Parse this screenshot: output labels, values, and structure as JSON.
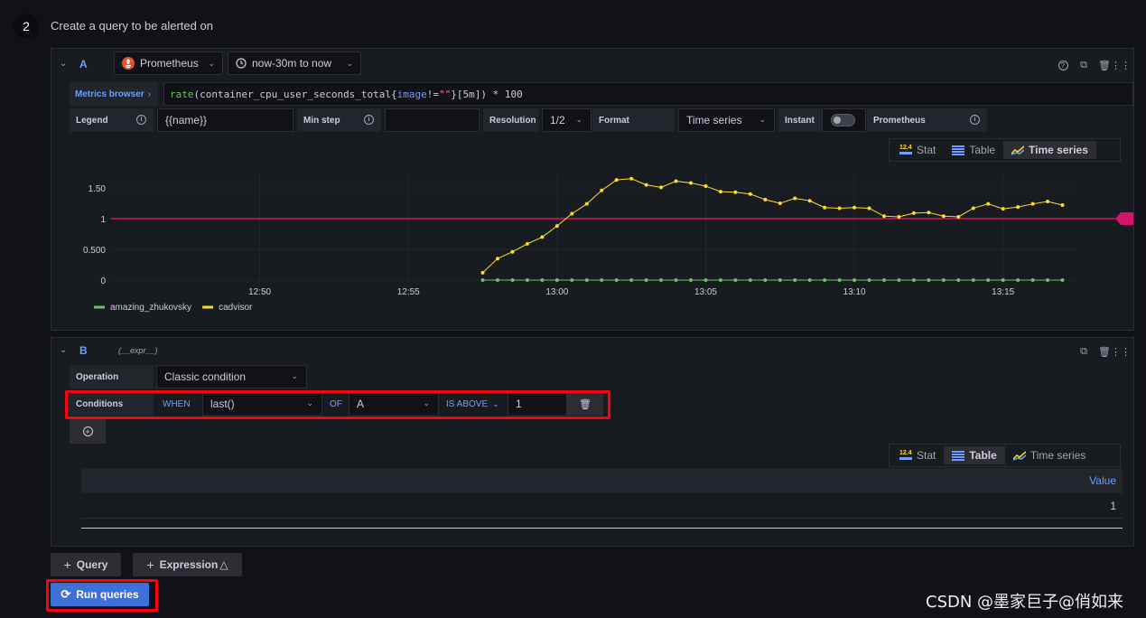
{
  "step": {
    "number": "2",
    "title": "Create a query to be alerted on"
  },
  "query_a": {
    "name": "A",
    "datasource": "Prometheus",
    "time_range": "now-30m to now",
    "metrics_browser": "Metrics browser",
    "expr_parts": [
      {
        "text": "rate",
        "color": "#73bf69"
      },
      {
        "text": "(container_cpu_user_seconds_total{",
        "color": "#ccccdc"
      },
      {
        "text": "image",
        "color": "#6e9fff"
      },
      {
        "text": "!=",
        "color": "#ccccdc"
      },
      {
        "text": "\"\"",
        "color": "#ff7383"
      },
      {
        "text": "}[5m]) * 100",
        "color": "#ccccdc"
      }
    ],
    "legend_label": "Legend",
    "legend_value": "{{name}}",
    "min_step_label": "Min step",
    "min_step_value": "",
    "resolution_label": "Resolution",
    "resolution_value": "1/2",
    "format_label": "Format",
    "format_value": "Time series",
    "instant_label": "Instant",
    "instant_on": false,
    "type_label": "Prometheus"
  },
  "viz_a": {
    "options": [
      "Stat",
      "Table",
      "Time series"
    ],
    "selected": "Time series"
  },
  "chart_data": {
    "type": "line",
    "x_ticks": [
      "12:50",
      "12:55",
      "13:00",
      "13:05",
      "13:10",
      "13:15"
    ],
    "y_ticks": [
      "0",
      "0.500",
      "1",
      "1.50"
    ],
    "ylim": [
      0,
      1.75
    ],
    "grid": true,
    "legend_position": "bottom-left",
    "threshold": {
      "value": 1,
      "label": "1",
      "color": "#d0156b"
    },
    "series": [
      {
        "name": "amazing_zhukovsky",
        "color": "#73bf69",
        "x_minutes_after_1230": [
          27.5,
          28,
          28.5,
          29,
          29.5,
          30,
          30.5,
          31,
          31.5,
          32,
          32.5,
          33,
          33.5,
          34,
          34.5,
          35,
          35.5,
          36,
          36.5,
          37,
          37.5,
          38,
          38.5,
          39,
          39.5,
          40,
          40.5,
          41,
          41.5,
          42,
          42.5,
          43,
          43.5,
          44,
          44.5,
          45,
          45.5,
          46,
          46.5,
          47
        ],
        "values": [
          0,
          0,
          0,
          0,
          0,
          0,
          0,
          0,
          0,
          0,
          0,
          0,
          0,
          0,
          0,
          0,
          0,
          0,
          0,
          0,
          0,
          0,
          0,
          0,
          0,
          0,
          0,
          0,
          0,
          0,
          0,
          0,
          0,
          0,
          0,
          0,
          0,
          0,
          0,
          0
        ]
      },
      {
        "name": "cadvisor",
        "color": "#fade2a",
        "x_minutes_after_1230": [
          27.5,
          28,
          28.5,
          29,
          29.5,
          30,
          30.5,
          31,
          31.5,
          32,
          32.5,
          33,
          33.5,
          34,
          34.5,
          35,
          35.5,
          36,
          36.5,
          37,
          37.5,
          38,
          38.5,
          39,
          39.5,
          40,
          40.5,
          41,
          41.5,
          42,
          42.5,
          43,
          43.5,
          44,
          44.5,
          45,
          45.5,
          46,
          46.5,
          47
        ],
        "values": [
          0.12,
          0.35,
          0.46,
          0.59,
          0.7,
          0.88,
          1.08,
          1.24,
          1.46,
          1.63,
          1.65,
          1.55,
          1.51,
          1.61,
          1.58,
          1.53,
          1.44,
          1.43,
          1.4,
          1.31,
          1.25,
          1.33,
          1.29,
          1.18,
          1.17,
          1.18,
          1.17,
          1.04,
          1.03,
          1.09,
          1.1,
          1.04,
          1.03,
          1.17,
          1.24,
          1.16,
          1.19,
          1.24,
          1.28,
          1.22
        ]
      }
    ]
  },
  "query_b": {
    "name": "B",
    "subtitle": "(__expr__)",
    "operation_label": "Operation",
    "operation_value": "Classic condition",
    "conditions_label": "Conditions",
    "when": "WHEN",
    "reducer": "last()",
    "of": "OF",
    "query_ref": "A",
    "evaluator": "IS ABOVE",
    "threshold": "1"
  },
  "viz_b": {
    "options": [
      "Stat",
      "Table",
      "Time series"
    ],
    "selected": "Table"
  },
  "table_b": {
    "header": "Value",
    "rows": [
      "1"
    ]
  },
  "buttons": {
    "query": "Query",
    "expression": "Expression",
    "run": "Run queries"
  },
  "watermark": "CSDN @墨家巨子@俏如来"
}
